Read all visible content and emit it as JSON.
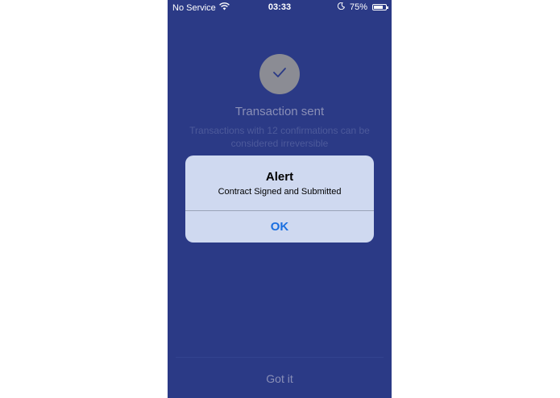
{
  "status_bar": {
    "carrier": "No Service",
    "time": "03:33",
    "battery": "75%",
    "battery_level": 0.75,
    "icons": [
      "wifi-icon",
      "moon-icon",
      "battery-icon"
    ]
  },
  "screen": {
    "title": "Transaction sent",
    "subtitle": "Transactions with 12 confirmations can be considered irreversible",
    "got_it_label": "Got it",
    "icon": "checkmark-icon",
    "colors": {
      "background": "#2b3a86",
      "check_circle": "#8b8c94"
    }
  },
  "alert": {
    "title": "Alert",
    "message": "Contract Signed and Submitted",
    "ok_label": "OK",
    "colors": {
      "background": "#cfd9f0",
      "button": "#1a6fe0"
    }
  }
}
